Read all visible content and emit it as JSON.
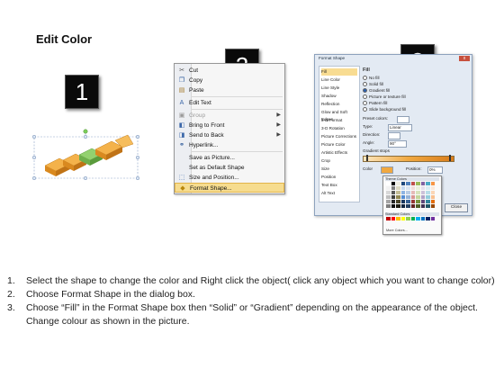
{
  "title": "Edit Color",
  "badges": [
    "1",
    "2",
    "3"
  ],
  "colors": {
    "arrow_orange": "#F2A43A",
    "arrow_green": "#8CCB6A",
    "menu_highlight": "#F6DC8F",
    "badge": "#0A0A0A"
  },
  "context_menu": {
    "items": [
      {
        "icon": "scissors-icon",
        "label": "Cut",
        "enabled": true,
        "submenu": false
      },
      {
        "icon": "copy-icon",
        "label": "Copy",
        "enabled": true,
        "submenu": false
      },
      {
        "icon": "paste-icon",
        "label": "Paste",
        "enabled": true,
        "submenu": false
      },
      {
        "icon": "edit-text-icon",
        "label": "Edit Text",
        "enabled": true,
        "submenu": false
      },
      {
        "icon": "group-icon",
        "label": "Group",
        "enabled": false,
        "submenu": true
      },
      {
        "icon": "bring-front-icon",
        "label": "Bring to Front",
        "enabled": true,
        "submenu": true
      },
      {
        "icon": "send-back-icon",
        "label": "Send to Back",
        "enabled": true,
        "submenu": true
      },
      {
        "icon": "hyperlink-icon",
        "label": "Hyperlink...",
        "enabled": true,
        "submenu": false
      },
      {
        "icon": "",
        "label": "Save as Picture...",
        "enabled": true,
        "submenu": false
      },
      {
        "icon": "",
        "label": "Set as Default Shape",
        "enabled": true,
        "submenu": false
      },
      {
        "icon": "size-icon",
        "label": "Size and Position...",
        "enabled": true,
        "submenu": false
      },
      {
        "icon": "format-shape-icon",
        "label": "Format Shape...",
        "enabled": true,
        "submenu": false,
        "active": true
      }
    ]
  },
  "format_dialog": {
    "title": "Format Shape",
    "close_glyph": "x",
    "nav": [
      "Fill",
      "Line Color",
      "Line Style",
      "Shadow",
      "Reflection",
      "Glow and Soft Edges",
      "3-D Format",
      "3-D Rotation",
      "Picture Corrections",
      "Picture Color",
      "Artistic Effects",
      "Crop",
      "Size",
      "Position",
      "Text Box",
      "Alt Text"
    ],
    "selected_nav": "Fill",
    "fill_heading": "Fill",
    "fill_options": [
      "No fill",
      "Solid fill",
      "Gradient fill",
      "Picture or texture fill",
      "Pattern fill",
      "Slide background fill"
    ],
    "selected_fill": "Gradient fill",
    "fields": {
      "preset_colors": "Preset colors:",
      "type": "Type:",
      "type_value": "Linear",
      "direction": "Direction:",
      "angle": "Angle:",
      "angle_value": "90°",
      "gradient_stops": "Gradient stops",
      "color": "Color",
      "position": "Position:",
      "position_value": "0%",
      "brightness": "Brightness:",
      "transparency": "Transparency:",
      "rotate": "Rotate with shape"
    },
    "close_button": "Close"
  },
  "palette": {
    "theme_label": "Theme Colors",
    "standard_label": "Standard Colors",
    "more": "More Colors...",
    "theme_top": [
      "#ffffff",
      "#000000",
      "#eeece1",
      "#1f497d",
      "#4f81bd",
      "#c0504d",
      "#9bbb59",
      "#8064a2",
      "#4bacc6",
      "#f79646"
    ],
    "theme_rows": [
      [
        "#f2f2f2",
        "#7f7f7f",
        "#ddd9c3",
        "#c6d9f0",
        "#dbe5f1",
        "#f2dcdb",
        "#ebf1dd",
        "#e5e0ec",
        "#dbeef3",
        "#fdeada"
      ],
      [
        "#d8d8d8",
        "#595959",
        "#c4bd97",
        "#8db3e2",
        "#b8cce4",
        "#e5b9b7",
        "#d7e3bc",
        "#ccc1d9",
        "#b7dde8",
        "#fbd5b5"
      ],
      [
        "#bfbfbf",
        "#3f3f3f",
        "#938953",
        "#548dd4",
        "#95b3d7",
        "#d99694",
        "#c3d69b",
        "#b2a2c7",
        "#92cddc",
        "#fac08f"
      ],
      [
        "#a5a5a5",
        "#262626",
        "#494429",
        "#17365d",
        "#366092",
        "#953734",
        "#76923c",
        "#5f497a",
        "#31859b",
        "#e36c09"
      ],
      [
        "#7f7f7f",
        "#0c0c0c",
        "#1d1b10",
        "#0f243e",
        "#244061",
        "#632423",
        "#4f6128",
        "#3f3151",
        "#205867",
        "#974806"
      ]
    ],
    "standard": [
      "#c00000",
      "#ff0000",
      "#ffc000",
      "#ffff00",
      "#92d050",
      "#00b050",
      "#00b0f0",
      "#0070c0",
      "#002060",
      "#7030a0"
    ]
  },
  "instructions": [
    {
      "num": "1.",
      "text": "Select the shape to change the color and Right click the object( click any object which you want to change color)"
    },
    {
      "num": "2.",
      "text": "Choose Format Shape in the dialog box."
    },
    {
      "num": "3.",
      "text": "Choose “Fill” in the Format Shape box then “Solid” or “Gradient” depending on the appearance of the object. Change colour as shown in the picture."
    }
  ]
}
